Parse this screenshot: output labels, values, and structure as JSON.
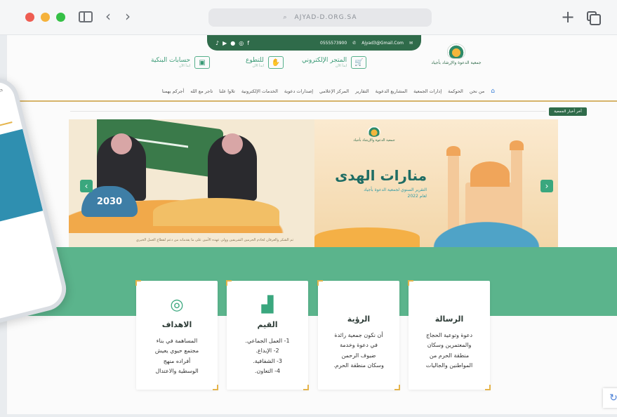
{
  "browser": {
    "url": "AJYAD-D.ORG.SA",
    "dot_colors": [
      "#ee5d52",
      "#f5b23c",
      "#35c046"
    ]
  },
  "topbar": {
    "social_icons": [
      "tiktok-icon",
      "youtube-icon",
      "snapchat-icon",
      "instagram-icon",
      "facebook-icon"
    ],
    "phone": "0555573900",
    "email": "Ajyad3@Gmail.Com"
  },
  "logo": {
    "text": "جمعية الدعوة والإرشاد بأجياد"
  },
  "services": [
    {
      "label": "المتجر الإلكتروني",
      "sub": "ابدأ الآن",
      "icon": "cart-icon"
    },
    {
      "label": "للتطوع",
      "sub": "ابدأ الآن",
      "icon": "handshake-icon"
    },
    {
      "label": "حسابات البنكية",
      "sub": "ابدأ الآن",
      "icon": "bank-icon"
    }
  ],
  "nav": {
    "items": [
      "من نحن",
      "الحوكمة",
      "إدارات الجمعية",
      "المشاريع الدعوية",
      "التقارير",
      "المركز الإعلامي",
      "إصدارات دعوية",
      "الخدمات الإلكترونية",
      "تلاوا علنا",
      "تاجر مع الله",
      "أجركم يهمنا"
    ]
  },
  "news_badge": "آخر أخبار الجمعية",
  "hero": {
    "vision_text": "2030",
    "left_caption": "ثم الشكر والعرفان لخادم الحرمين الشريفين وولي عهده الأمين على ما يقدمانه من دعم لقطاع العمل الخيري",
    "right_logo_text": "جمعية الدعوة والإرشاد بأجياد",
    "title": "منارات الهدى",
    "subtitle_line1": "التقرير السنوي لجمعية الدعوة بأجياد",
    "subtitle_line2": "لعام 2022"
  },
  "cards": [
    {
      "icon": "target-icon",
      "title": "الاهداف",
      "lines": [
        "المساهمة في بناء",
        "مجتمع حيوي يعيش",
        "أفراده منهج",
        "الوسطية والاعتدال"
      ]
    },
    {
      "icon": "stairs-icon",
      "title": "القيم",
      "lines": [
        "1- العمل الجماعي.",
        "2- الإبداع.",
        "3- الشفافية.",
        "4- التعاون."
      ]
    },
    {
      "icon": "",
      "title": "الرؤية",
      "lines": [
        "أن نكون جمعية رائدة",
        "في دعوة وخدمة",
        "ضيوف الرحمن",
        "وسكان منطقة الحرم."
      ]
    },
    {
      "icon": "",
      "title": "الرسالة",
      "lines": [
        "دعوة وتوعية الحجاج",
        "والمعتمرين وسكان",
        "منطقة الحرم من",
        "المواطنين والجاليات"
      ]
    }
  ]
}
